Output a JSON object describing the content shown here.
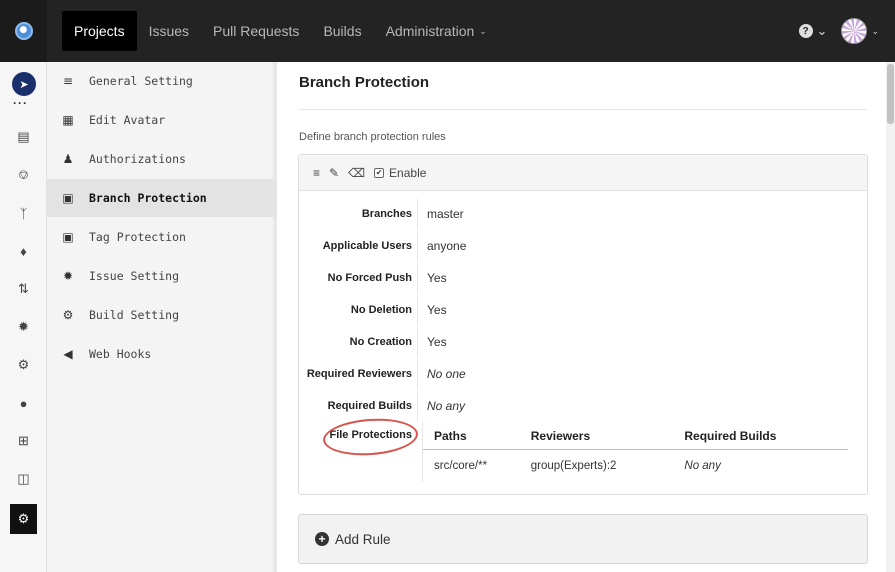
{
  "nav": {
    "items": [
      "Projects",
      "Issues",
      "Pull Requests",
      "Builds",
      "Administration"
    ],
    "active": "Projects"
  },
  "sidebar": {
    "items": [
      {
        "label": "General Setting",
        "icon": "sliders-icon"
      },
      {
        "label": "Edit Avatar",
        "icon": "image-icon"
      },
      {
        "label": "Authorizations",
        "icon": "user-icon"
      },
      {
        "label": "Branch Protection",
        "icon": "lock-icon"
      },
      {
        "label": "Tag Protection",
        "icon": "lock-icon"
      },
      {
        "label": "Issue Setting",
        "icon": "bug-icon"
      },
      {
        "label": "Build Setting",
        "icon": "cogs-icon"
      },
      {
        "label": "Web Hooks",
        "icon": "volume-icon"
      }
    ],
    "active": "Branch Protection"
  },
  "page": {
    "title": "Branch Protection",
    "description": "Define branch protection rules"
  },
  "rule": {
    "enable_label": "Enable",
    "enabled": true,
    "fields": [
      {
        "label": "Branches",
        "value": "master"
      },
      {
        "label": "Applicable Users",
        "value": "anyone"
      },
      {
        "label": "No Forced Push",
        "value": "Yes"
      },
      {
        "label": "No Deletion",
        "value": "Yes"
      },
      {
        "label": "No Creation",
        "value": "Yes"
      },
      {
        "label": "Required Reviewers",
        "value": "No one"
      },
      {
        "label": "Required Builds",
        "value": "No any"
      }
    ],
    "file_protections": {
      "label": "File Protections",
      "columns": [
        "Paths",
        "Reviewers",
        "Required Builds"
      ],
      "rows": [
        {
          "path": "src/core/**",
          "reviewers": "group(Experts):2",
          "builds": "No any"
        }
      ]
    }
  },
  "add_rule_label": "Add Rule",
  "colors": {
    "topbar": "#232323",
    "annotation_circle": "#d9534f"
  }
}
